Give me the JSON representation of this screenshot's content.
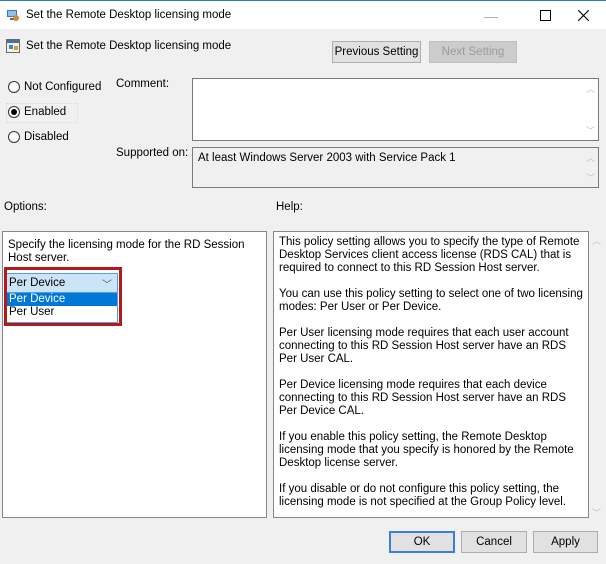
{
  "window": {
    "title": "Set the Remote Desktop licensing mode",
    "minimize_icon": "minimize-icon",
    "maximize_icon": "maximize-icon",
    "close_icon": "close-icon"
  },
  "header": {
    "policy_title": "Set the Remote Desktop licensing mode",
    "previous_setting": "Previous Setting",
    "next_setting": "Next Setting"
  },
  "state": {
    "options": [
      {
        "label": "Not Configured",
        "selected": false
      },
      {
        "label": "Enabled",
        "selected": true
      },
      {
        "label": "Disabled",
        "selected": false
      }
    ]
  },
  "comment": {
    "label": "Comment:",
    "value": ""
  },
  "supported_on": {
    "label": "Supported on:",
    "value": "At least Windows Server 2003 with Service Pack 1"
  },
  "options_section": {
    "label": "Options:",
    "description": "Specify the licensing mode for the RD Session Host server.",
    "combo_value": "Per Device",
    "dropdown_items": [
      {
        "label": "Per Device",
        "highlighted": true
      },
      {
        "label": "Per User",
        "highlighted": false
      }
    ],
    "highlight_color": "#b31b1b"
  },
  "help_section": {
    "label": "Help:",
    "paragraphs": [
      "This policy setting allows you to specify the type of Remote Desktop Services client access license (RDS CAL) that is required to connect to this RD Session Host server.",
      "You can use this policy setting to select one of two licensing modes: Per User or Per Device.",
      "Per User licensing mode requires that each user account connecting to this RD Session Host server have an RDS Per User CAL.",
      "Per Device licensing mode requires that each device connecting to this RD Session Host server have an RDS Per Device CAL.",
      "If you enable this policy setting, the Remote Desktop licensing mode that you specify is honored by the Remote Desktop license server.",
      "If you disable or do not configure this policy setting, the licensing mode is not specified at the Group Policy level."
    ]
  },
  "footer": {
    "ok": "OK",
    "cancel": "Cancel",
    "apply": "Apply"
  }
}
